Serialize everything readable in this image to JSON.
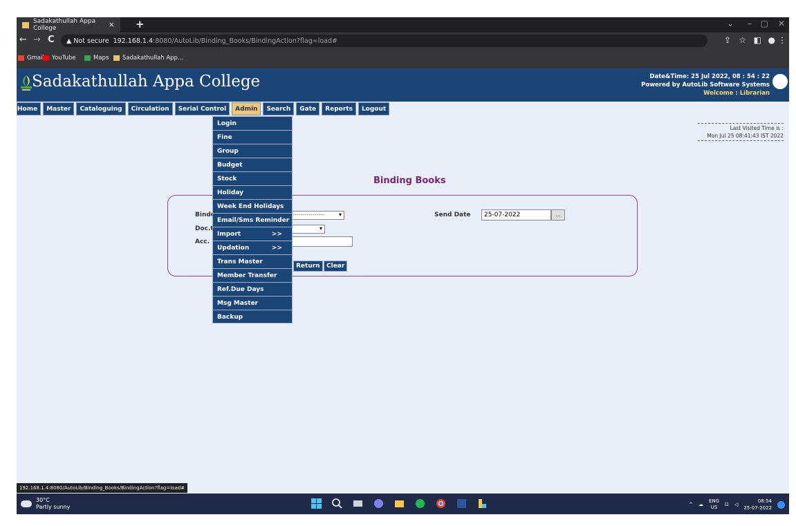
{
  "browser": {
    "tab_title": "Sadakathullah Appa College",
    "tab_close": "×",
    "new_tab": "+",
    "nav_back": "←",
    "nav_forward": "→",
    "nav_reload": "C",
    "security": "▲ Not secure",
    "url_host": "192.168.1.4",
    "url_path": ":8080/AutoLib/Binding_Books/BindingAction?flag=load#",
    "bookmarks": [
      {
        "label": "Gmail",
        "color": "#ea4335"
      },
      {
        "label": "YouTube",
        "color": "#ff0000"
      },
      {
        "label": "Maps",
        "color": "#34a853"
      },
      {
        "label": "Sadakathullah App...",
        "color": "#e8c46a"
      }
    ],
    "status_url": "192.168.1.4:8080/AutoLib/Binding_Books/BindingAction?flag=load#"
  },
  "header": {
    "college_name": "Sadakathullah Appa College",
    "datetime_label": "Date&Time:",
    "datetime_value": "25 Jul 2022, 08 : 54 : 22",
    "powered_by": "Powered by AutoLib Software Systems",
    "welcome_label": "Welcome",
    "welcome_user": ":  Librarian"
  },
  "menu": {
    "items": [
      "Home",
      "Master",
      "Cataloguing",
      "Circulation",
      "Serial Control",
      "Admin",
      "Search",
      "Gate",
      "Reports",
      "Logout"
    ],
    "active": "Admin"
  },
  "admin_dropdown": [
    {
      "label": "Login",
      "arrow": ""
    },
    {
      "label": "Fine",
      "arrow": ""
    },
    {
      "label": "Group",
      "arrow": ""
    },
    {
      "label": "Budget",
      "arrow": ""
    },
    {
      "label": "Stock",
      "arrow": ""
    },
    {
      "label": "Holiday",
      "arrow": ""
    },
    {
      "label": "Week End Holidays",
      "arrow": ""
    },
    {
      "label": "Email/Sms Reminder",
      "arrow": ""
    },
    {
      "label": "Import",
      "arrow": ">>"
    },
    {
      "label": "Updation",
      "arrow": ">>"
    },
    {
      "label": "Trans Master",
      "arrow": ""
    },
    {
      "label": "Member Transfer",
      "arrow": ""
    },
    {
      "label": "Ref.Due Days",
      "arrow": ""
    },
    {
      "label": "Msg Master",
      "arrow": ""
    },
    {
      "label": "Backup",
      "arrow": ""
    }
  ],
  "last_visited": {
    "label": "Last Visited Time is :",
    "value": "Mon Jul 25 08:41:43 IST 2022"
  },
  "page": {
    "title": "Binding Books",
    "binder_label": "Binder",
    "binder_value": "----------------",
    "doctype_label": "Doc.ty",
    "accno_label": "Acc. N",
    "send_date_label": "Send Date",
    "send_date_value": "25-07-2022",
    "calendar_button": "...",
    "return_button": "Return",
    "clear_button": "Clear"
  },
  "taskbar": {
    "temperature": "30°C",
    "weather": "Partly sunny",
    "language": "ENG",
    "region": "US",
    "time": "08:54",
    "date": "25-07-2022"
  }
}
